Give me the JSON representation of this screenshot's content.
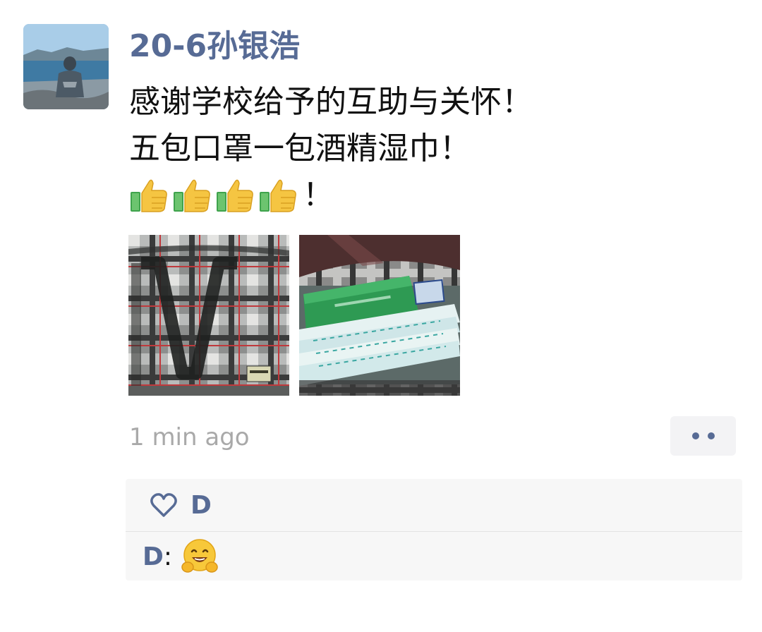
{
  "post": {
    "author": "20-6孙银浩",
    "lines": [
      "感谢学校给予的互助与关怀！",
      "五包口罩一包酒精湿巾！"
    ],
    "emoji_line_suffix": "！",
    "thumbs_up_count": 4,
    "time": "1 min ago"
  },
  "interactions": {
    "likes": [
      "D"
    ],
    "comments": [
      {
        "author": "D",
        "separator": ":",
        "emoji": "grinning-hugging-face"
      }
    ]
  },
  "colors": {
    "name_blue": "#576b95",
    "time_gray": "#a9a9a9",
    "interaction_bg": "#f7f7f7"
  },
  "icons": {
    "avatar": "person-on-lake-shore-photo",
    "thumb": "thumbs-up-emoji",
    "more": "ellipsis-two-dots-icon",
    "like": "heart-outline-icon"
  }
}
